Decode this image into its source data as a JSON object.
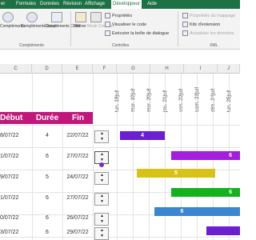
{
  "menu": {
    "tabs": [
      "er",
      "Formules",
      "Données",
      "Révision",
      "Affichage",
      "Développeur",
      "Aide"
    ]
  },
  "ribbon": {
    "complements": "Compléments",
    "complements_excel": "Compléments Excel",
    "complements_com": "Compléments COM",
    "inserer": "Insérer",
    "mode_creation": "Mode Création",
    "proprietes": "Propriétés",
    "visualiser_code": "Visualiser le code",
    "executer_boite": "Exécuter la boîte de dialogue",
    "controles": "Contrôles",
    "proprietes_mappage": "Propriétés du mappage",
    "kits_extension": "Kits d'extension",
    "actualiser_donnees": "Actualiser les données",
    "xml": "XML",
    "group_complements": "Compléments"
  },
  "grid": {
    "col_letters": [
      "C",
      "D",
      "E",
      "F",
      "G",
      "H",
      "I",
      "J"
    ],
    "headers": {
      "debut": "Début",
      "duree": "Durée",
      "fin": "Fin"
    },
    "dates": [
      "lun. 18juil",
      "mar. 19juil",
      "mer. 20juil",
      "jeu. 21juil",
      "ven. 22juil",
      "sam. 23juil",
      "dim. 24juil",
      "lun. 25juil"
    ],
    "rows": [
      {
        "debut": "8/07/22",
        "duree": "4",
        "fin": "22/07/22",
        "bar_label": "4"
      },
      {
        "debut": "1/07/22",
        "duree": "6",
        "fin": "27/07/22",
        "bar_label": "6"
      },
      {
        "debut": "9/07/22",
        "duree": "5",
        "fin": "24/07/22",
        "bar_label": "5"
      },
      {
        "debut": "1/07/22",
        "duree": "6",
        "fin": "27/07/22",
        "bar_label": "6"
      },
      {
        "debut": "0/07/22",
        "duree": "6",
        "fin": "26/07/22",
        "bar_label": "6"
      },
      {
        "debut": "3/07/22",
        "duree": "6",
        "fin": "29/07/22",
        "bar_label": ""
      }
    ]
  },
  "colors": {
    "header": "#c0187a",
    "bars": [
      "#6a1fd1",
      "#a31ee0",
      "#d8c21a",
      "#14b31e",
      "#3b86d1",
      "#6a1fd1"
    ]
  }
}
